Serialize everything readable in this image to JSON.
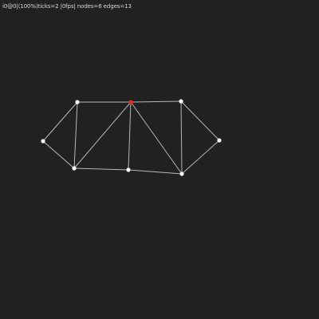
{
  "status": {
    "text": "i0@0|(100%)ticks=2 |0fps| nodes=6 edges=13"
  },
  "graph": {
    "node_color": "#ffffff",
    "selected_node_color": "#ff2020",
    "edge_color": "#b8b8b8",
    "background": "#212121",
    "nodes": [
      {
        "id": "n-top-left"
      },
      {
        "id": "n-top-middle",
        "selected": true
      },
      {
        "id": "n-top-right"
      },
      {
        "id": "n-left"
      },
      {
        "id": "n-right"
      },
      {
        "id": "n-bottom-left"
      },
      {
        "id": "n-bottom-middle"
      },
      {
        "id": "n-bottom-right"
      }
    ],
    "edges": [
      [
        "n-top-left",
        "n-top-middle"
      ],
      [
        "n-top-middle",
        "n-top-right"
      ],
      [
        "n-left",
        "n-top-left"
      ],
      [
        "n-left",
        "n-bottom-left"
      ],
      [
        "n-top-left",
        "n-bottom-left"
      ],
      [
        "n-bottom-left",
        "n-top-middle"
      ],
      [
        "n-top-middle",
        "n-bottom-middle"
      ],
      [
        "n-top-middle",
        "n-bottom-right"
      ],
      [
        "n-bottom-left",
        "n-bottom-middle"
      ],
      [
        "n-bottom-middle",
        "n-bottom-right"
      ],
      [
        "n-top-right",
        "n-bottom-right"
      ],
      [
        "n-top-right",
        "n-right"
      ],
      [
        "n-right",
        "n-bottom-right"
      ]
    ]
  }
}
